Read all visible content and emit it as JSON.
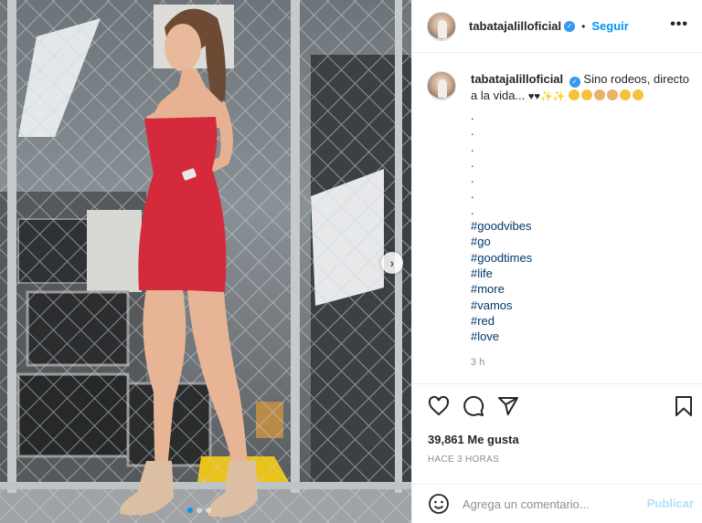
{
  "post": {
    "username": "tabatajalilloficial",
    "follow_label": "Seguir",
    "separator": "•",
    "more_label": "•••",
    "verified_mark": "✓"
  },
  "caption": {
    "username": "tabatajalilloficial",
    "text": "Sino rodeos, directo a la vida...",
    "symbols": "♥♥✨✨",
    "dots": [
      ".",
      ".",
      ".",
      ".",
      ".",
      ".",
      "."
    ],
    "hashtags": [
      "#goodvibes",
      "#go",
      "#goodtimes",
      "#life",
      "#more",
      "#vamos",
      "#red",
      "#love"
    ],
    "relative_time": "3 h"
  },
  "engagement": {
    "likes": "39,861 Me gusta",
    "posted_ago": "HACE 3 HORAS"
  },
  "comment": {
    "placeholder": "Agrega un comentario...",
    "publish_label": "Publicar"
  },
  "carousel": {
    "next_label": "›",
    "total_slides": 3,
    "active_slide": 1
  },
  "colors": {
    "accent": "#0095f6",
    "verified": "#3897f0",
    "hashtag": "#00376b",
    "dress": "#d42a3c"
  },
  "icons": [
    "heart-icon",
    "comment-icon",
    "share-icon",
    "bookmark-icon",
    "emoji-icon",
    "more-options-icon",
    "carousel-next-icon"
  ]
}
